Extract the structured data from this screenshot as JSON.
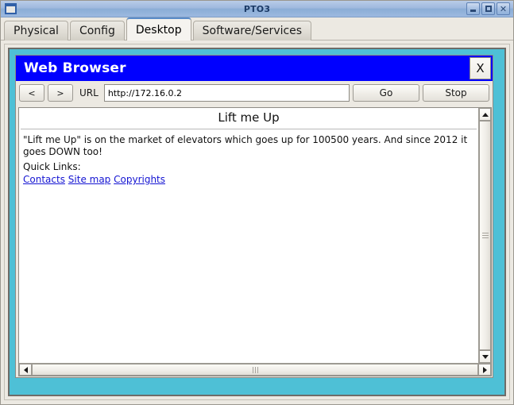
{
  "window": {
    "title": "PTO3",
    "icon": "window-icon",
    "controls": [
      {
        "name": "minimize",
        "glyph": "minimize-icon"
      },
      {
        "name": "maximize",
        "glyph": "maximize-icon"
      },
      {
        "name": "close",
        "glyph": "close-icon"
      }
    ]
  },
  "tabs": [
    {
      "label": "Physical",
      "active": false
    },
    {
      "label": "Config",
      "active": false
    },
    {
      "label": "Desktop",
      "active": true
    },
    {
      "label": "Software/Services",
      "active": false
    }
  ],
  "browser": {
    "title": "Web Browser",
    "close_label": "X",
    "toolbar": {
      "back_label": "<",
      "forward_label": ">",
      "url_label": "URL",
      "url_value": "http://172.16.0.2",
      "url_placeholder": "http://",
      "go_label": "Go",
      "stop_label": "Stop"
    },
    "page": {
      "heading": "Lift me Up",
      "paragraph": "\"Lift me Up\" is on the market of elevators which goes up for 100500 years. And since 2012 it goes DOWN too!",
      "quick_links_label": "Quick Links:",
      "links": [
        {
          "label": "Contacts"
        },
        {
          "label": "Site map"
        },
        {
          "label": "Copyrights"
        }
      ],
      "link_color": "#1414d2"
    }
  },
  "theme": {
    "titlebar_blue": "#9fb9de",
    "browser_title_blue": "#0000ff",
    "desktop_cyan": "#4ec0d6",
    "chrome_gray": "#ece9e2"
  }
}
